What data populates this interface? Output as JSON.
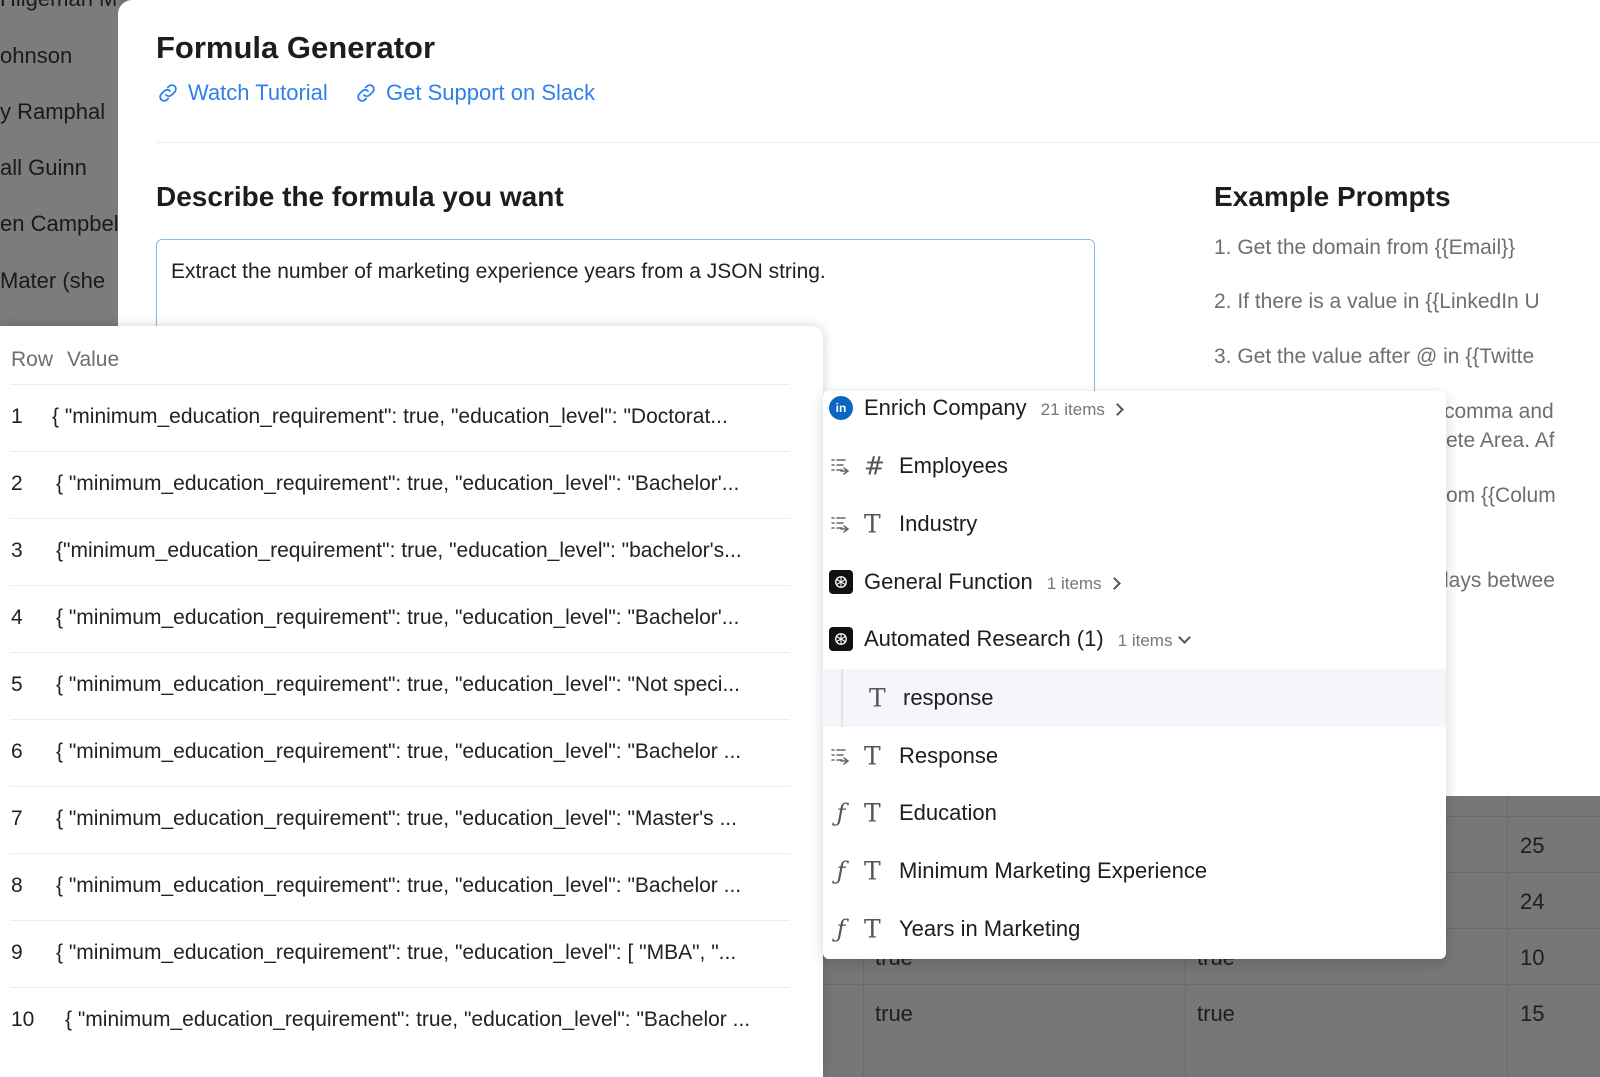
{
  "background": {
    "names": [
      "Hilgeman M",
      "ohnson",
      "y Ramphal",
      "all Guinn",
      "en Campbel",
      "Mater (she"
    ],
    "grid_rows": [
      {
        "col_a": "",
        "col_b": "",
        "col_c": "25"
      },
      {
        "col_a": "",
        "col_b": "",
        "col_c": "24"
      },
      {
        "col_a": "true",
        "col_b": "true",
        "col_c": "10"
      },
      {
        "col_a": "true",
        "col_b": "true",
        "col_c": "15"
      }
    ]
  },
  "modal": {
    "title": "Formula Generator",
    "links": [
      {
        "label": "Watch Tutorial",
        "icon": "link-icon"
      },
      {
        "label": "Get Support on Slack",
        "icon": "link-icon"
      }
    ],
    "describe_heading": "Describe the formula you want",
    "prompt_value": "Extract the number of marketing experience years from a JSON string.",
    "examples_heading": "Example Prompts",
    "examples": [
      "1. Get the domain from {{Email}}",
      "2. If there is a value in {{LinkedIn U",
      "3. Get the value after @ in {{Twitte",
      "comma and",
      "ete Area. Af",
      "om {{Colum",
      "lays betwee"
    ]
  },
  "preview": {
    "header_row": "Row",
    "header_value": "Value",
    "rows": [
      {
        "num": "1",
        "value": "{ \"minimum_education_requirement\": true, \"education_level\": \"Doctorat..."
      },
      {
        "num": "2",
        "value": "{ \"minimum_education_requirement\": true, \"education_level\": \"Bachelor'..."
      },
      {
        "num": "3",
        "value": "{\"minimum_education_requirement\": true, \"education_level\": \"bachelor's..."
      },
      {
        "num": "4",
        "value": "{ \"minimum_education_requirement\": true, \"education_level\": \"Bachelor'..."
      },
      {
        "num": "5",
        "value": "{ \"minimum_education_requirement\": true, \"education_level\": \"Not speci..."
      },
      {
        "num": "6",
        "value": "{ \"minimum_education_requirement\": true, \"education_level\": \"Bachelor ..."
      },
      {
        "num": "7",
        "value": "{ \"minimum_education_requirement\": true, \"education_level\": \"Master's ..."
      },
      {
        "num": "8",
        "value": "{ \"minimum_education_requirement\": true, \"education_level\": \"Bachelor ..."
      },
      {
        "num": "9",
        "value": "{ \"minimum_education_requirement\": true, \"education_level\": [ \"MBA\", \"..."
      },
      {
        "num": "10",
        "value": "{ \"minimum_education_requirement\": true, \"education_level\": \"Bachelor ..."
      }
    ]
  },
  "dropdown": {
    "items": [
      {
        "label": "Enrich Company",
        "count": "21 items",
        "icon": "linkedin-icon",
        "chevron": "right"
      },
      {
        "label": "Employees",
        "type": "#",
        "lead": "list-arrow-icon"
      },
      {
        "label": "Industry",
        "type": "T",
        "lead": "list-arrow-icon"
      },
      {
        "label": "General Function",
        "count": "1 items",
        "icon": "openai-icon",
        "chevron": "right"
      },
      {
        "label": "Automated Research (1)",
        "count": "1 items",
        "icon": "openai-icon",
        "chevron": "down"
      },
      {
        "label": "response",
        "type": "T",
        "selected": true
      },
      {
        "label": "Response",
        "type": "T",
        "lead": "list-arrow-icon"
      },
      {
        "label": "Education",
        "type": "T",
        "lead": "function-icon"
      },
      {
        "label": "Minimum Marketing Experience",
        "type": "T",
        "lead": "function-icon"
      },
      {
        "label": "Years in Marketing",
        "type": "T",
        "lead": "function-icon"
      }
    ]
  },
  "colors": {
    "accent": "#2f80ed",
    "linkedin": "#0a66c2",
    "selected_row": "#f4f6fb"
  }
}
